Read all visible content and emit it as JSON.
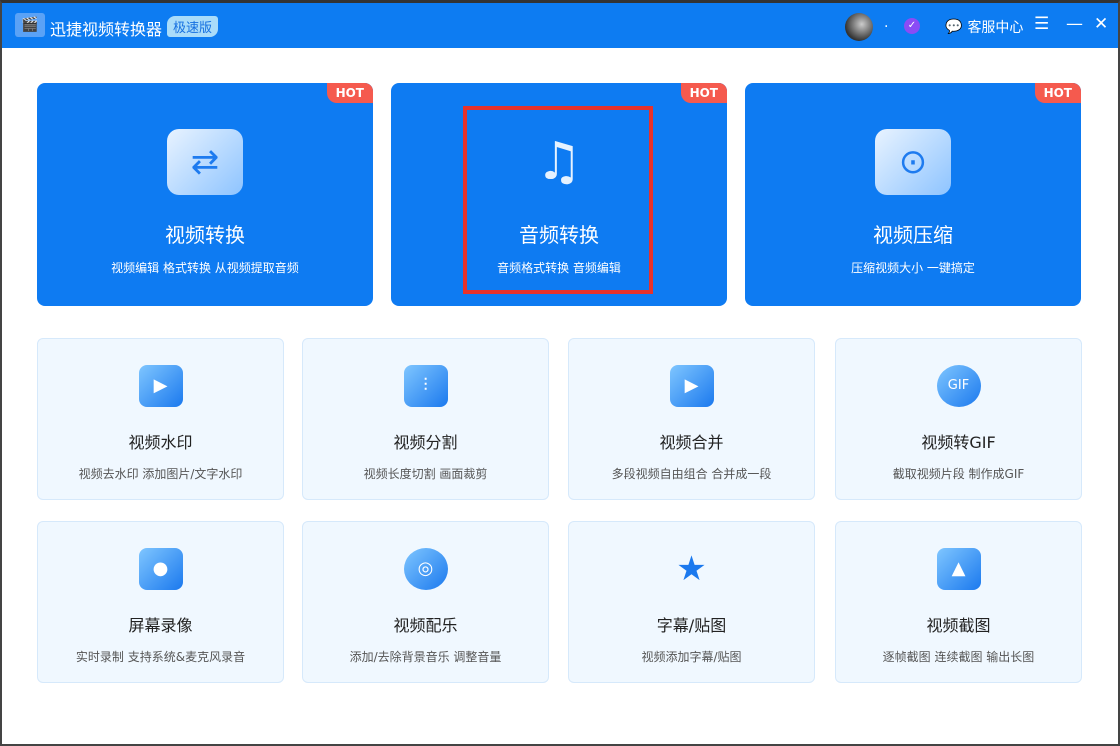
{
  "app": {
    "title": "迅捷视频转换器",
    "edition": "极速版",
    "user_suffix": ".",
    "service": "客服中心"
  },
  "big_cards": [
    {
      "title": "视频转换",
      "subtitle": "视频编辑 格式转换 从视频提取音频",
      "badge": "HOT",
      "icon": "video-convert-icon"
    },
    {
      "title": "音频转换",
      "subtitle": "音频格式转换 音频编辑",
      "badge": "HOT",
      "icon": "music-note-icon"
    },
    {
      "title": "视频压缩",
      "subtitle": "压缩视频大小 一键搞定",
      "badge": "HOT",
      "icon": "compress-icon"
    }
  ],
  "small_cards": [
    {
      "title": "视频水印",
      "subtitle": "视频去水印 添加图片/文字水印"
    },
    {
      "title": "视频分割",
      "subtitle": "视频长度切割 画面裁剪"
    },
    {
      "title": "视频合并",
      "subtitle": "多段视频自由组合 合并成一段"
    },
    {
      "title": "视频转GIF",
      "subtitle": "截取视频片段 制作成GIF"
    },
    {
      "title": "屏幕录像",
      "subtitle": "实时录制 支持系统&麦克风录音"
    },
    {
      "title": "视频配乐",
      "subtitle": "添加/去除背景音乐 调整音量"
    },
    {
      "title": "字幕/贴图",
      "subtitle": "视频添加字幕/贴图"
    },
    {
      "title": "视频截图",
      "subtitle": "逐帧截图 连续截图 输出长图"
    }
  ]
}
